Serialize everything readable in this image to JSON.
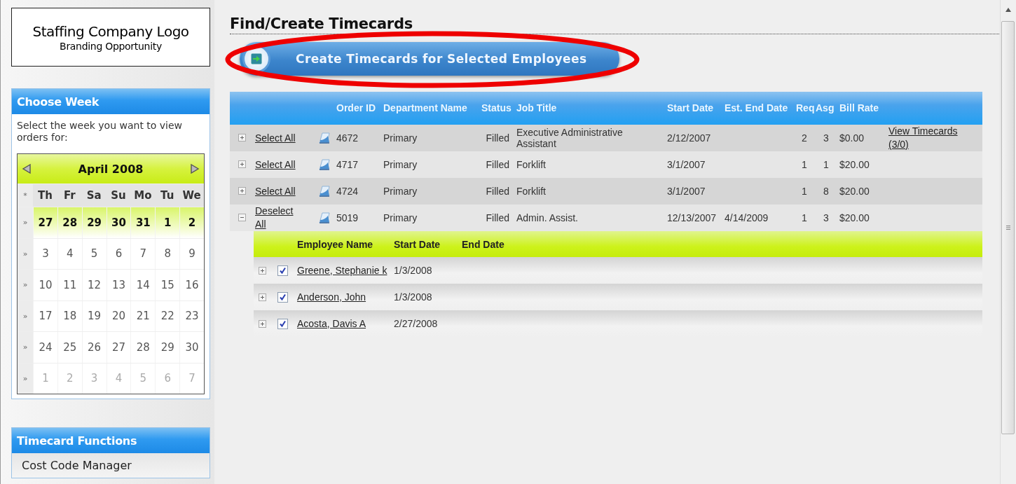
{
  "logo": {
    "title": "Staffing Company Logo",
    "subtitle": "Branding Opportunity"
  },
  "week_panel": {
    "title": "Choose Week",
    "instructions": "Select the week you want to view orders for:",
    "calendar": {
      "month": "April 2008",
      "corner": "*",
      "weekdays": [
        "Th",
        "Fr",
        "Sa",
        "Su",
        "Mo",
        "Tu",
        "We"
      ],
      "weeks": [
        {
          "marker": "»",
          "selected": true,
          "dimmed": false,
          "days": [
            "27",
            "28",
            "29",
            "30",
            "31",
            "1",
            "2"
          ]
        },
        {
          "marker": "»",
          "selected": false,
          "dimmed": false,
          "days": [
            "3",
            "4",
            "5",
            "6",
            "7",
            "8",
            "9"
          ]
        },
        {
          "marker": "»",
          "selected": false,
          "dimmed": false,
          "days": [
            "10",
            "11",
            "12",
            "13",
            "14",
            "15",
            "16"
          ]
        },
        {
          "marker": "»",
          "selected": false,
          "dimmed": false,
          "days": [
            "17",
            "18",
            "19",
            "20",
            "21",
            "22",
            "23"
          ]
        },
        {
          "marker": "»",
          "selected": false,
          "dimmed": false,
          "days": [
            "24",
            "25",
            "26",
            "27",
            "28",
            "29",
            "30"
          ]
        },
        {
          "marker": "»",
          "selected": false,
          "dimmed": true,
          "days": [
            "1",
            "2",
            "3",
            "4",
            "5",
            "6",
            "7"
          ]
        }
      ]
    }
  },
  "functions_panel": {
    "title": "Timecard Functions",
    "items": [
      "Cost Code Manager"
    ]
  },
  "page_title": "Find/Create Timecards",
  "create_button": {
    "label": "Create Timecards for Selected Employees",
    "highlighted": true
  },
  "orders": {
    "columns": [
      "Order ID",
      "Department Name",
      "Status",
      "Job Title",
      "Start Date",
      "Est. End Date",
      "Req",
      "Asg",
      "Bill Rate"
    ],
    "rows": [
      {
        "expanded": false,
        "select_label": "Select All",
        "order_id": "4672",
        "department": "Primary",
        "status": "Filled",
        "job_title": "Executive Administrative Assistant",
        "start_date": "2/12/2007",
        "est_end_date": "",
        "req": "2",
        "asg": "3",
        "bill_rate": "$0.00",
        "link": "View Timecards (3/0)"
      },
      {
        "expanded": false,
        "select_label": "Select All",
        "order_id": "4717",
        "department": "Primary",
        "status": "Filled",
        "job_title": "Forklift",
        "start_date": "3/1/2007",
        "est_end_date": "",
        "req": "1",
        "asg": "1",
        "bill_rate": "$20.00",
        "link": ""
      },
      {
        "expanded": false,
        "select_label": "Select All",
        "order_id": "4724",
        "department": "Primary",
        "status": "Filled",
        "job_title": "Forklift",
        "start_date": "3/1/2007",
        "est_end_date": "",
        "req": "1",
        "asg": "8",
        "bill_rate": "$20.00",
        "link": ""
      },
      {
        "expanded": true,
        "select_label": "Deselect All",
        "order_id": "5019",
        "department": "Primary",
        "status": "Filled",
        "job_title": "Admin. Assist.",
        "start_date": "12/13/2007",
        "est_end_date": "4/14/2009",
        "req": "1",
        "asg": "3",
        "bill_rate": "$20.00",
        "link": "",
        "employees": {
          "columns": [
            "Employee Name",
            "Start Date",
            "End Date"
          ],
          "rows": [
            {
              "expanded": false,
              "checked": true,
              "name": "Greene, Stephanie k",
              "start_date": "1/3/2008"
            },
            {
              "expanded": false,
              "checked": true,
              "name": "Anderson, John",
              "start_date": "1/3/2008"
            },
            {
              "expanded": false,
              "checked": true,
              "name": "Acosta, Davis A",
              "start_date": "2/27/2008"
            }
          ]
        }
      }
    ]
  }
}
